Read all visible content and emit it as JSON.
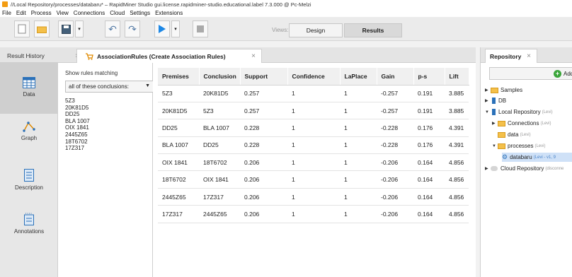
{
  "window": {
    "title": "//Local Repository/processes/databaru* – RapidMiner Studio gui.license.rapidminer-studio.educational.label 7.3.000 @ Pc-Melzi"
  },
  "menu": [
    "File",
    "Edit",
    "Process",
    "View",
    "Connections",
    "Cloud",
    "Settings",
    "Extensions"
  ],
  "toolbar": {
    "views_label": "Views:",
    "design": "Design",
    "results": "Results"
  },
  "tabs": {
    "result_history": "Result History",
    "association_rules": "AssociationRules (Create Association Rules)",
    "close": "×"
  },
  "nav": [
    {
      "label": "Data",
      "icon": "table-icon"
    },
    {
      "label": "Graph",
      "icon": "graph-icon"
    },
    {
      "label": "Description",
      "icon": "description-icon"
    },
    {
      "label": "Annotations",
      "icon": "annotations-icon"
    }
  ],
  "rules_filter": {
    "label": "Show rules matching",
    "selected": "all of these conclusions:",
    "conclusions": [
      "5Z3",
      "20K81D5",
      "DD25",
      "BLA 1007",
      "OIX 1841",
      "2445Z65",
      "18T6702",
      "17Z317"
    ]
  },
  "table": {
    "headers": [
      "Premises",
      "Conclusion",
      "Support",
      "Confidence",
      "LaPlace",
      "Gain",
      "p-s",
      "Lift"
    ],
    "rows": [
      [
        "5Z3",
        "20K81D5",
        "0.257",
        "1",
        "1",
        "-0.257",
        "0.191",
        "3.885"
      ],
      [
        "20K81D5",
        "5Z3",
        "0.257",
        "1",
        "1",
        "-0.257",
        "0.191",
        "3.885"
      ],
      [
        "DD25",
        "BLA 1007",
        "0.228",
        "1",
        "1",
        "-0.228",
        "0.176",
        "4.391"
      ],
      [
        "BLA 1007",
        "DD25",
        "0.228",
        "1",
        "1",
        "-0.228",
        "0.176",
        "4.391"
      ],
      [
        "OIX 1841",
        "18T6702",
        "0.206",
        "1",
        "1",
        "-0.206",
        "0.164",
        "4.856"
      ],
      [
        "18T6702",
        "OIX 1841",
        "0.206",
        "1",
        "1",
        "-0.206",
        "0.164",
        "4.856"
      ],
      [
        "2445Z65",
        "17Z317",
        "0.206",
        "1",
        "1",
        "-0.206",
        "0.164",
        "4.856"
      ],
      [
        "17Z317",
        "2445Z65",
        "0.206",
        "1",
        "1",
        "-0.206",
        "0.164",
        "4.856"
      ]
    ]
  },
  "repository": {
    "tab": "Repository",
    "add_data": "Add Da",
    "samples": "Samples",
    "db": "DB",
    "local_repo": "Local Repository",
    "local_repo_owner": "(Levi)",
    "connections": "Connections",
    "connections_owner": "(Levi)",
    "data": "data",
    "data_owner": "(Levi)",
    "processes": "processes",
    "processes_owner": "(Levi)",
    "databaru": "databaru",
    "databaru_meta": "(Levi - v1, 9",
    "cloud_repo": "Cloud Repository",
    "cloud_meta": "(disconne"
  },
  "colors": {
    "accent_blue": "#1e88e5",
    "folder": "#f4c04a",
    "selection": "#cfe1f7"
  }
}
